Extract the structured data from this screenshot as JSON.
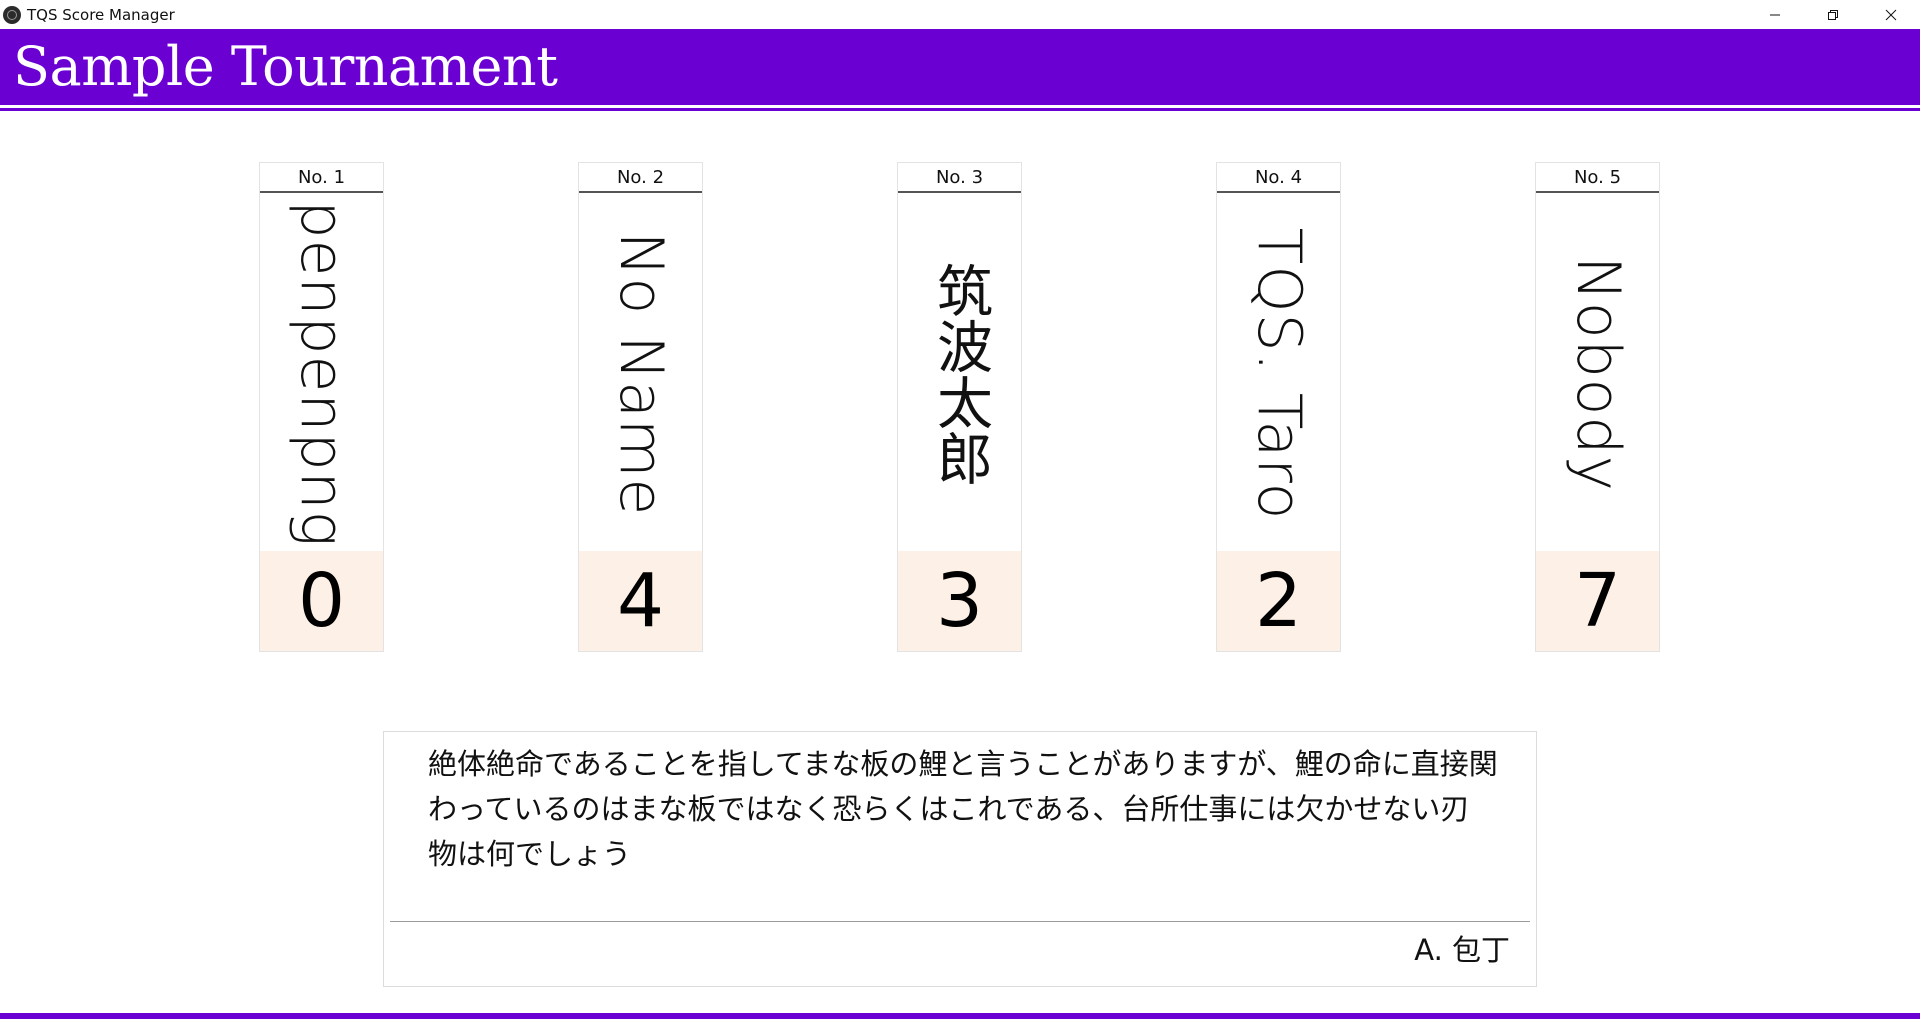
{
  "window": {
    "title": "TQS Score Manager"
  },
  "header": {
    "title": "Sample Tournament"
  },
  "players": [
    {
      "no": "No. 1",
      "name": "penpenpng",
      "score": "0"
    },
    {
      "no": "No. 2",
      "name": "No Name",
      "score": "4"
    },
    {
      "no": "No. 3",
      "name": "筑波太郎",
      "score": "3"
    },
    {
      "no": "No. 4",
      "name": "TQS. Taro",
      "score": "2"
    },
    {
      "no": "No. 5",
      "name": "Nobody",
      "score": "7"
    }
  ],
  "question": {
    "text": "絶体絶命であることを指してまな板の鯉と言うことがありますが、鯉の命に直接関わっているのはまな板ではなく恐らくはこれである、台所仕事には欠かせない刃物は何でしょう",
    "answer": "A. 包丁"
  },
  "colors": {
    "accent": "#6a00d2",
    "score_background": "#fdf0e6"
  },
  "icons": {
    "minimize": "minimize-icon",
    "restore": "restore-icon",
    "close": "close-icon",
    "app": "app-icon"
  }
}
